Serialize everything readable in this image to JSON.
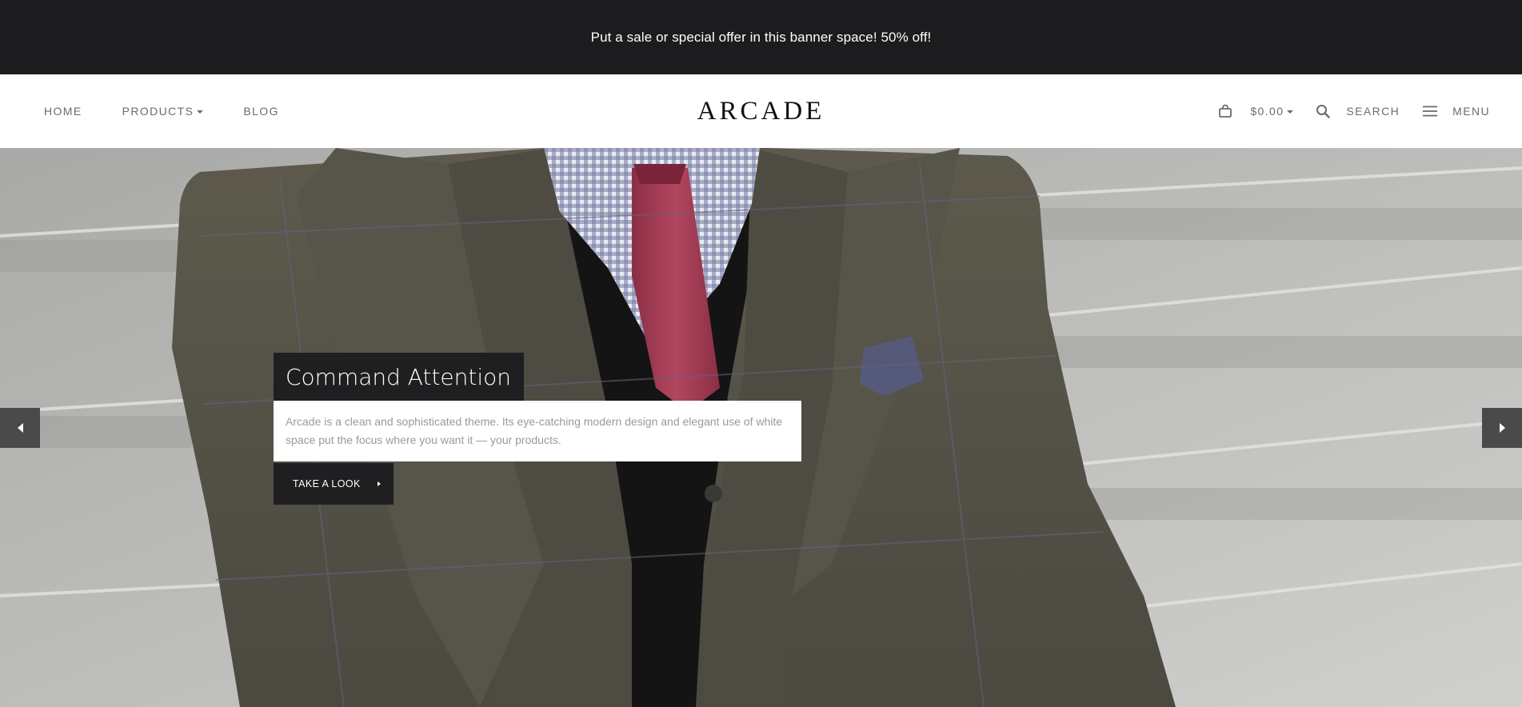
{
  "banner": {
    "text": "Put a sale or special offer in this banner space! 50% off!"
  },
  "header": {
    "nav": {
      "home": "HOME",
      "products": "PRODUCTS",
      "blog": "BLOG"
    },
    "logo": "ARCADE",
    "cart_total": "$0.00",
    "search_label": "SEARCH",
    "menu_label": "MENU"
  },
  "hero": {
    "title": "Command Attention",
    "text": "Arcade is a clean and sophisticated theme. Its eye-catching modern design and elegant use of white space put the focus where you want it — your products.",
    "button_label": "TAKE A LOOK",
    "image_subject": "man in tweed three-piece suit with red tie on stone steps"
  },
  "colors": {
    "banner_bg": "#1c1b1d",
    "nav_text": "#6b6b6b",
    "caption_dark": "#1f1e20",
    "caption_text": "#9a9a9a",
    "slider_arrow_bg": "#4a4a4b"
  },
  "icons": {
    "cart": "shopping-bag-icon",
    "search": "magnifier-icon",
    "menu": "hamburger-icon",
    "prev": "triangle-left-icon",
    "next": "triangle-right-icon"
  }
}
